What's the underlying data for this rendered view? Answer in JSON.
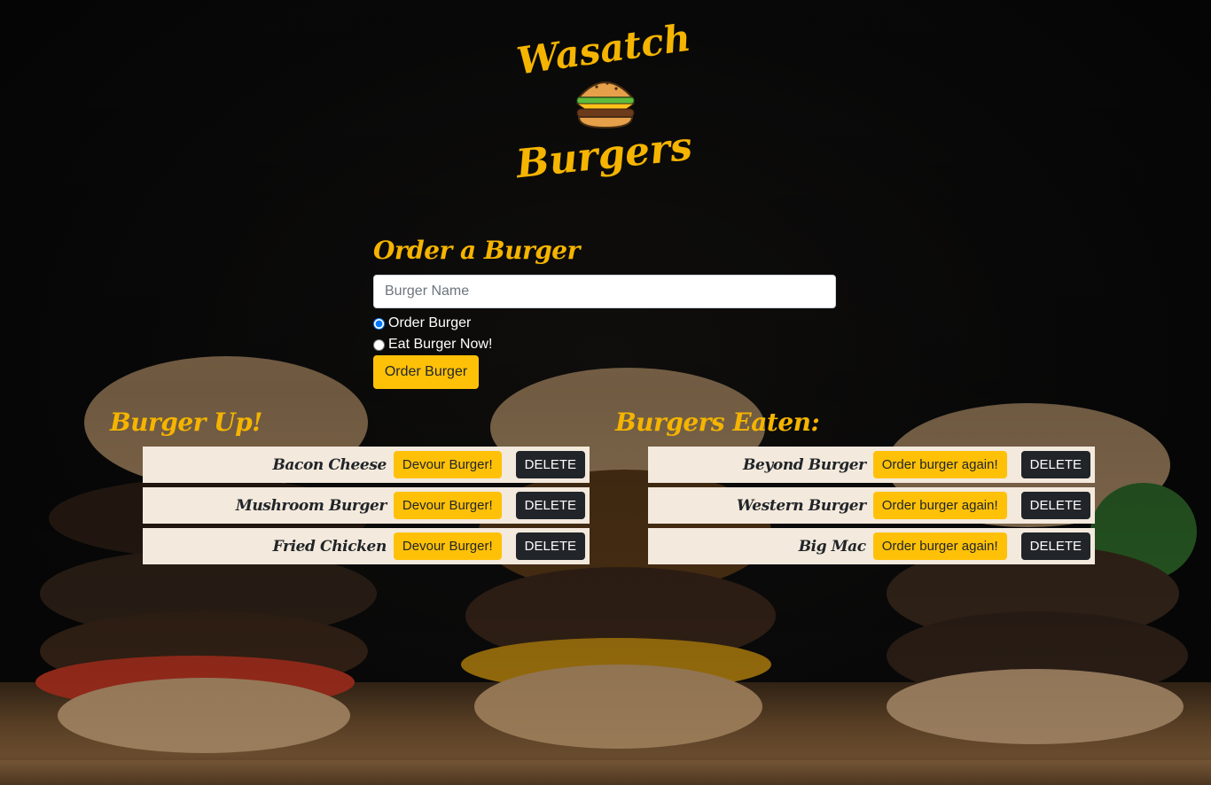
{
  "logo": {
    "line1": "Wasatch",
    "line2": "Burgers",
    "icon": "burger-icon"
  },
  "order_form": {
    "title": "Order a Burger",
    "name_placeholder": "Burger Name",
    "name_value": "",
    "radio_options": [
      "Order Burger",
      "Eat Burger Now!"
    ],
    "selected_option": "Order Burger",
    "submit_label": "Order Burger"
  },
  "burger_up": {
    "title": "Burger Up!",
    "items": [
      {
        "name": "Bacon Cheese",
        "action_label": "Devour Burger!",
        "delete_label": "DELETE"
      },
      {
        "name": "Mushroom Burger",
        "action_label": "Devour Burger!",
        "delete_label": "DELETE"
      },
      {
        "name": "Fried Chicken",
        "action_label": "Devour Burger!",
        "delete_label": "DELETE"
      }
    ]
  },
  "burgers_eaten": {
    "title": "Burgers Eaten:",
    "items": [
      {
        "name": "Beyond Burger",
        "action_label": "Order burger again!",
        "delete_label": "DELETE"
      },
      {
        "name": "Western Burger",
        "action_label": "Order burger again!",
        "delete_label": "DELETE"
      },
      {
        "name": "Big Mac",
        "action_label": "Order burger again!",
        "delete_label": "DELETE"
      }
    ]
  },
  "colors": {
    "accent": "#f5b400",
    "button_yellow": "#ffc107",
    "button_dark": "#212529",
    "row_bg": "#f3e9dc"
  }
}
